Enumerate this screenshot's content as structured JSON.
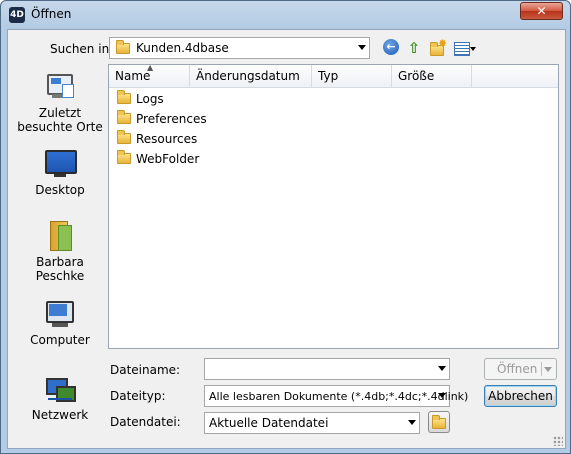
{
  "window": {
    "title": "Öffnen",
    "app_icon_text": "4D",
    "close_symbol": "✕"
  },
  "toolbar": {
    "look_in_label": "Suchen in:",
    "look_in_value": "Kunden.4dbase",
    "icons": [
      "back-icon",
      "up-folder-icon",
      "new-folder-icon",
      "view-menu-icon"
    ]
  },
  "places": [
    {
      "label": "Zuletzt besuchte Orte",
      "icon": "recent-places-icon"
    },
    {
      "label": "Desktop",
      "icon": "desktop-icon"
    },
    {
      "label": "Barbara Peschke",
      "icon": "user-folder-icon"
    },
    {
      "label": "Computer",
      "icon": "computer-icon"
    },
    {
      "label": "Netzwerk",
      "icon": "network-icon"
    }
  ],
  "file_list": {
    "columns": [
      "Name",
      "Änderungsdatum",
      "Typ",
      "Größe"
    ],
    "sort_column": "Name",
    "rows": [
      {
        "name": "Logs",
        "icon": "folder-icon"
      },
      {
        "name": "Preferences",
        "icon": "folder-icon"
      },
      {
        "name": "Resources",
        "icon": "folder-icon"
      },
      {
        "name": "WebFolder",
        "icon": "folder-icon"
      }
    ]
  },
  "fields": {
    "filename_label": "Dateiname:",
    "filename_value": "",
    "filetype_label": "Dateityp:",
    "filetype_value": "Alle lesbaren Dokumente (*.4db;*.4dc;*.4dlink)",
    "datafile_label": "Datendatei:",
    "datafile_value": "Aktuelle Datendatei"
  },
  "buttons": {
    "open": "Öffnen",
    "cancel": "Abbrechen"
  },
  "colors": {
    "title_bar": "#b3cbe3",
    "close_button": "#c85a3e",
    "client_bg": "#f0f0f0",
    "list_bg": "#ffffff"
  }
}
